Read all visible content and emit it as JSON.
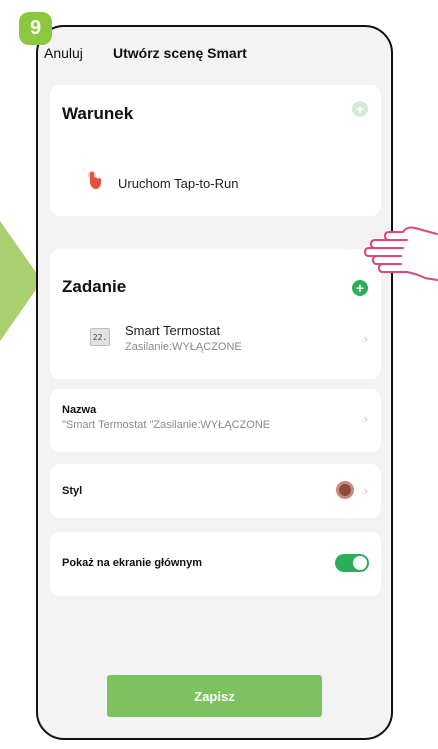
{
  "step": {
    "number": "9"
  },
  "header": {
    "cancel_label": "Anuluj",
    "title": "Utwórz scenę Smart"
  },
  "condition_card": {
    "title": "Warunek",
    "item_label": "Uruchom Tap-to-Run",
    "item_icon": "tap-hand-icon"
  },
  "task_card": {
    "title": "Zadanie",
    "device_name": "Smart Termostat",
    "device_status": "Zasilanie:WYŁĄCZONE",
    "device_icon_text": "22."
  },
  "name_row": {
    "label": "Nazwa",
    "value": "\"Smart Termostat \"Zasilanie:WYŁĄCZONE"
  },
  "style_row": {
    "label": "Styl"
  },
  "show_row": {
    "label": "Pokaż na ekranie głównym",
    "enabled": true
  },
  "footer": {
    "save_label": "Zapisz"
  },
  "colors": {
    "accent_green": "#2cad57",
    "button_green": "#7cc261",
    "badge_green": "#8dc63f",
    "screen_bg": "#f3f3f3"
  }
}
